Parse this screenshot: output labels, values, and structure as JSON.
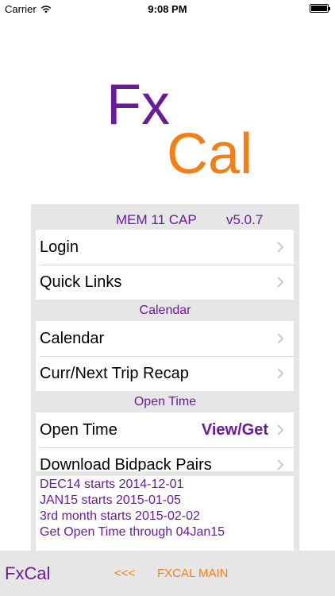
{
  "status_bar": {
    "carrier": "Carrier",
    "time": "9:08 PM"
  },
  "logo": {
    "fx": "Fx",
    "cal": "Cal"
  },
  "panel": {
    "caption": "MEM 11 CAP",
    "version": "v5.0.7",
    "group1": [
      {
        "label": "Login"
      },
      {
        "label": "Quick Links"
      }
    ],
    "section_calendar": "Calendar",
    "group2": [
      {
        "label": "Calendar"
      },
      {
        "label": "Curr/Next Trip Recap"
      }
    ],
    "section_open_time": "Open Time",
    "group3": [
      {
        "label": "Open Time",
        "value": "View/Get"
      },
      {
        "label": "Download Bidpack Pairs"
      }
    ],
    "date_lines": [
      "DEC14 starts 2014-12-01",
      "JAN15 starts 2015-01-05",
      "3rd month starts 2015-02-02",
      "Get Open Time through 04Jan15"
    ]
  },
  "bottom_bar": {
    "app_name": "FxCal",
    "back": "<<<",
    "main": "FXCAL MAIN"
  },
  "colors": {
    "purple": "#6a1b9a",
    "orange": "#f57f17",
    "panel_bg": "#e6e6e6",
    "chevron": "#c7c7cc"
  }
}
